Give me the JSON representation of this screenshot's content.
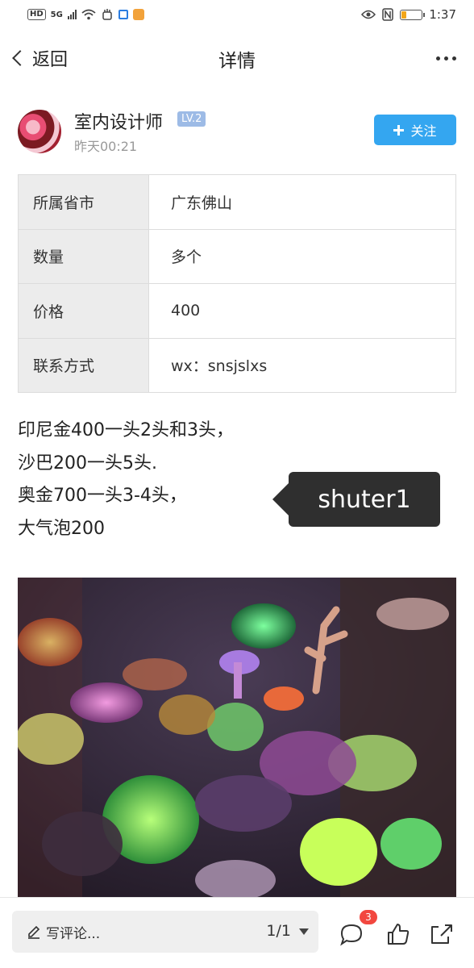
{
  "status_bar": {
    "network_tag": "HD",
    "signal_tag": "5G",
    "time": "1:37"
  },
  "nav": {
    "back_label": "返回",
    "title": "详情"
  },
  "author": {
    "name": "室内设计师",
    "level": "LV.2",
    "time": "昨天00:21",
    "follow_label": "关注"
  },
  "info": {
    "rows": [
      {
        "key": "所属省市",
        "value": "广东佛山"
      },
      {
        "key": "数量",
        "value": "多个"
      },
      {
        "key": "价格",
        "value": "400"
      },
      {
        "key": "联系方式",
        "value": "wx：snsjslxs"
      }
    ]
  },
  "description": {
    "lines": [
      "印尼金400一头2头和3头，",
      "沙巴200一头5头.",
      "奥金700一头3-4头，",
      "大气泡200"
    ]
  },
  "tooltip": {
    "text": "shuter1"
  },
  "bottom_bar": {
    "comment_placeholder": "写评论...",
    "page_indicator": "1/1",
    "comment_count": "3"
  },
  "icons": {
    "back": "chevron-left-icon",
    "more": "more-dots-icon",
    "follow": "plus-icon",
    "pen": "pen-icon",
    "dropdown": "caret-down-icon",
    "comment": "comment-bubble-icon",
    "like": "thumbs-up-icon",
    "share": "share-icon"
  },
  "colors": {
    "accent": "#34a6f0",
    "badge": "#f2473f",
    "level_badge": "#9dbbe6",
    "tooltip_bg": "#2f2f2f"
  }
}
